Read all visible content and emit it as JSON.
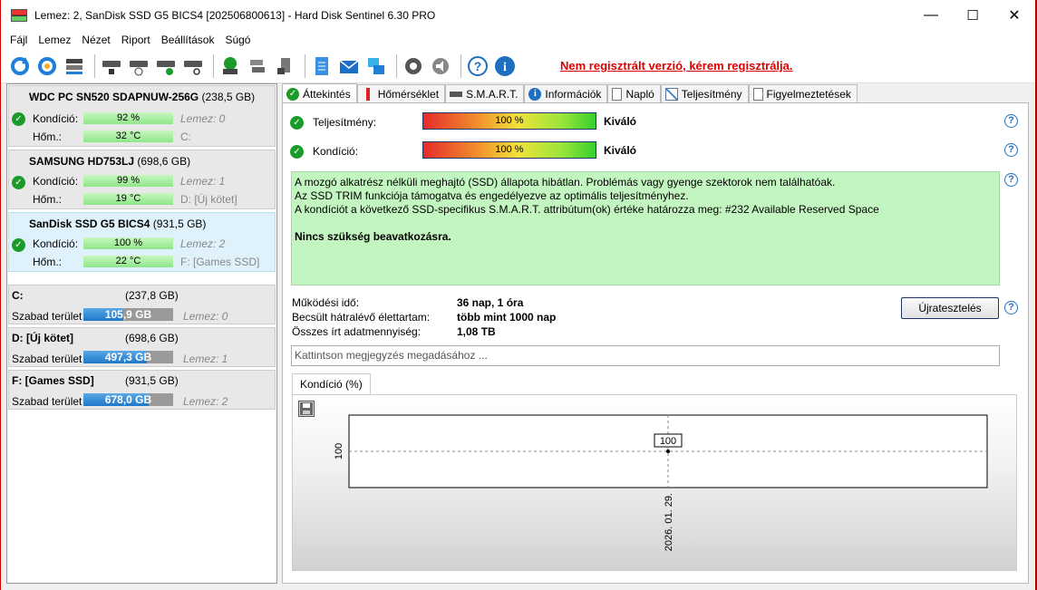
{
  "window": {
    "title": "Lemez: 2, SanDisk SSD G5 BICS4 [202506800613]  -  Hard Disk Sentinel 6.30 PRO",
    "minimize": "—",
    "maximize": "☐",
    "close": "✕"
  },
  "menu": [
    "Fájl",
    "Lemez",
    "Nézet",
    "Riport",
    "Beállítások",
    "Súgó"
  ],
  "toolbar": {
    "register_text": "Nem regisztrált verzió, kérem regisztrálja."
  },
  "disks": [
    {
      "name": "WDC PC SN520 SDAPNUW-256G",
      "size": "(238,5 GB)",
      "cond_label": "Kondíció:",
      "cond": "92 %",
      "cond_pct": 92,
      "cond_hint": "Lemez: 0",
      "temp_label": "Hőm.:",
      "temp": "32 °C",
      "temp_hint": "C:"
    },
    {
      "name": "SAMSUNG HD753LJ",
      "size": "(698,6 GB)",
      "cond_label": "Kondíció:",
      "cond": "99 %",
      "cond_pct": 99,
      "cond_hint": "Lemez: 1",
      "temp_label": "Hőm.:",
      "temp": "19 °C",
      "temp_hint": "D: [Új kötet]"
    },
    {
      "name": "SanDisk SSD G5 BICS4",
      "size": "(931,5 GB)",
      "cond_label": "Kondíció:",
      "cond": "100 %",
      "cond_pct": 100,
      "cond_hint": "Lemez: 2",
      "temp_label": "Hőm.:",
      "temp": "22 °C",
      "temp_hint": "F: [Games SSD]"
    }
  ],
  "partitions": [
    {
      "name": "C:",
      "size": "(237,8 GB)",
      "free_label": "Szabad terület",
      "free": "105,9 GB",
      "free_pct": 44.5,
      "hint": "Lemez: 0"
    },
    {
      "name": "D: [Új kötet]",
      "size": "(698,6 GB)",
      "free_label": "Szabad terület",
      "free": "497,3 GB",
      "free_pct": 71.2,
      "hint": "Lemez: 1"
    },
    {
      "name": "F: [Games SSD]",
      "size": "(931,5 GB)",
      "free_label": "Szabad terület",
      "free": "678,0 GB",
      "free_pct": 72.8,
      "hint": "Lemez: 2"
    }
  ],
  "tabs": [
    "Áttekintés",
    "Hőmérséklet",
    "S.M.A.R.T.",
    "Információk",
    "Napló",
    "Teljesítmény",
    "Figyelmeztetések"
  ],
  "overview": {
    "perf_label": "Teljesítmény:",
    "perf_value": "100 %",
    "perf_rating": "Kiváló",
    "cond_label": "Kondíció:",
    "cond_value": "100 %",
    "cond_rating": "Kiváló",
    "message": [
      "A mozgó alkatrész nélküli meghajtó (SSD) állapota hibátlan. Problémás vagy gyenge szektorok nem találhatóak.",
      "Az SSD TRIM funkciója támogatva és engedélyezve az optimális teljesítményhez.",
      "A kondíciót a következő SSD-specifikus S.M.A.R.T. attribútum(ok) értéke határozza meg:  #232 Available Reserved Space"
    ],
    "message_bold": "Nincs szükség beavatkozásra.",
    "uptime_label": "Működési idő:",
    "uptime_value": "36 nap, 1 óra",
    "life_label": "Becsült hátralévő élettartam:",
    "life_value": "több mint 1000 nap",
    "written_label": "Összes írt adatmennyiség:",
    "written_value": "1,08 TB",
    "retest_button": "Újratesztelés",
    "note_placeholder": "Kattintson megjegyzés megadásához ...",
    "chart_tab": "Kondíció  (%)"
  },
  "chart_data": {
    "type": "line",
    "x": [
      "2026. 01. 29."
    ],
    "series": [
      {
        "values": [
          100
        ]
      }
    ],
    "y_tick": "100",
    "point_label": "100",
    "ylim": [
      99,
      101
    ]
  }
}
